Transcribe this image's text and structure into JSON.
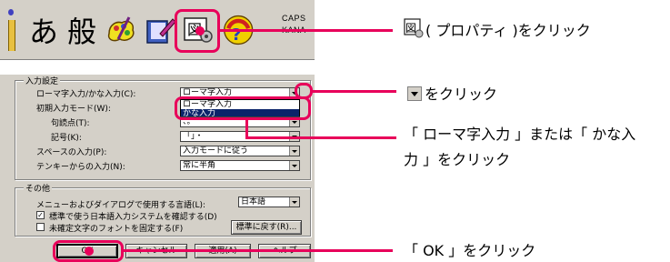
{
  "toolbar": {
    "input_mode": "あ",
    "conversion_mode": "般",
    "caps_label": "CAPS",
    "kana_label": "KANA",
    "icons": [
      "ime-grip-icon",
      "pad-icon",
      "dictionary-icon",
      "property-icon",
      "help-icon"
    ]
  },
  "dialog": {
    "input_group_title": "入力設定",
    "romaji_kana_label": "ローマ字入力/かな入力(C):",
    "romaji_kana_value": "ローマ字入力",
    "romaji_kana_options": [
      "ローマ字入力",
      "かな入力"
    ],
    "initial_mode_label": "初期入力モード(W):",
    "punctuation_label": "句読点(T):",
    "punctuation_value": "、。",
    "symbol_label": "記号(K):",
    "symbol_value": "「」・",
    "space_label": "スペースの入力(P):",
    "space_value": "入力モードに従う",
    "tenkey_label": "テンキーからの入力(N):",
    "tenkey_value": "常に半角",
    "other_group_title": "その他",
    "menu_lang_label": "メニューおよびダイアログで使用する言語(L):",
    "menu_lang_value": "日本語",
    "check1_label": "標準で使う日本語入力システムを確認する(D)",
    "check1_checked": true,
    "check2_label": "未確定文字のフォントを固定する(F)",
    "check2_checked": false,
    "reset_button": "標準に戻す(R)...",
    "ok_button": "OK",
    "cancel_button": "キャンセル",
    "apply_button": "適用(A)",
    "help_button": "ヘルプ"
  },
  "instructions": {
    "step1_suffix": "( プロパティ )をクリック",
    "step2_suffix": "をクリック",
    "step3_line1": "「 ローマ字入力 」または「 かな入",
    "step3_line2": "力 」をクリック",
    "step4": "「 OK 」をクリック"
  },
  "colors": {
    "callout": "#e8005a",
    "dialog_bg": "#d4d0c8",
    "selection": "#0a246a"
  }
}
